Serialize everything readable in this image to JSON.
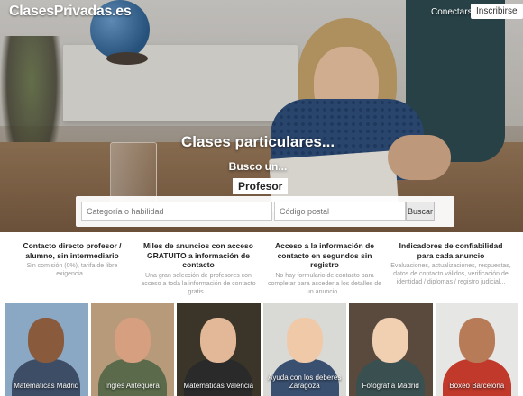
{
  "header": {
    "logo": "ClasesPrivadas.es",
    "login_label": "Conectarse",
    "signup_label": "Inscribirse"
  },
  "hero": {
    "title": "Clases particulares...",
    "subtitle": "Busco un...",
    "selected_type": "Profesor",
    "search": {
      "category_placeholder": "Categoría o habilidad",
      "postal_placeholder": "Código postal",
      "button_label": "Buscar"
    }
  },
  "features": [
    {
      "title": "Contacto directo profesor / alumno, sin intermediario",
      "desc": "Sin comisión (0%), tarifa de libre exigencia..."
    },
    {
      "title": "Miles de anuncios con acceso GRATUITO a información de contacto",
      "desc": "Una gran selección de profesores con acceso a toda la información de contacto gratis..."
    },
    {
      "title": "Acceso a la información de contacto en segundos sin registro",
      "desc": "No hay formulario de contacto para completar para acceder a los detalles de un anuncio..."
    },
    {
      "title": "Indicadores de confiabilidad para cada anuncio",
      "desc": "Evaluaciones, actualizaciones, respuestas, datos de contacto válidos, verificación de identidad / diplomas / registro judicial..."
    }
  ],
  "tutors": [
    {
      "label": "Matemáticas Madrid",
      "bg": "#8aa7c4",
      "skin": "#8a5a3c",
      "shirt": "#3d4d66"
    },
    {
      "label": "Inglés Antequera",
      "bg": "#b79a7a",
      "skin": "#d6a080",
      "shirt": "#5a6a4a"
    },
    {
      "label": "Matemáticas Valencia",
      "bg": "#3a3528",
      "skin": "#e2b898",
      "shirt": "#2a2a2a"
    },
    {
      "label": "Ayuda con los deberes Zaragoza",
      "bg": "#d9d9d6",
      "skin": "#f0c9a8",
      "shirt": "#3a5070"
    },
    {
      "label": "Fotografía Madrid",
      "bg": "#5a4a3e",
      "skin": "#f1cfb1",
      "shirt": "#3a5050"
    },
    {
      "label": "Boxeo Barcelona",
      "bg": "#e6e6e4",
      "skin": "#b77b58",
      "shirt": "#c0392b"
    }
  ]
}
